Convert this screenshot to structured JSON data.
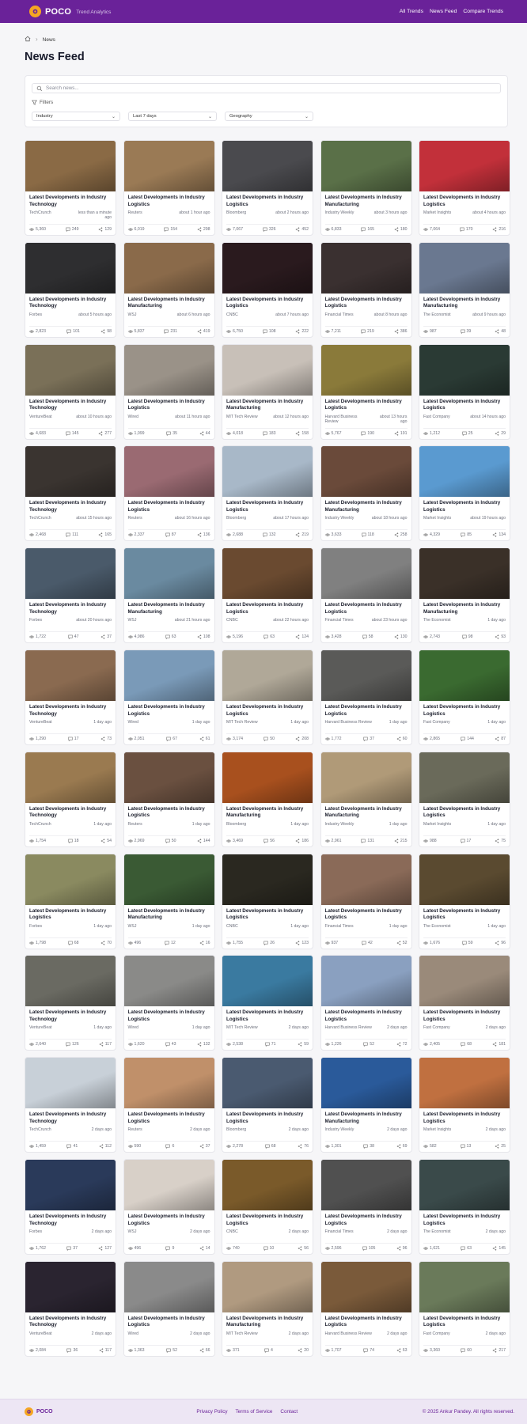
{
  "header": {
    "brand": "POCO",
    "tagline": "Trend Analytics",
    "nav": [
      "All Trends",
      "News Feed",
      "Compare Trends"
    ]
  },
  "breadcrumb": {
    "current": "News"
  },
  "page_title": "News Feed",
  "search": {
    "placeholder": "Search news..."
  },
  "filters": {
    "label": "Filters",
    "selects": [
      "Industry",
      "Last 7 days",
      "Geography"
    ]
  },
  "colors": {
    "brand": "#6a2299",
    "accent": "#f5a623"
  },
  "articles": [
    {
      "title": "Latest Developments in Industry Technology",
      "source": "TechCrunch",
      "time": "less than a minute ago",
      "views": "5,360",
      "comments": "249",
      "shares": "129",
      "img": "#8a6a45"
    },
    {
      "title": "Latest Developments in Industry Logistics",
      "source": "Reuters",
      "time": "about 1 hour ago",
      "views": "6,019",
      "comments": "154",
      "shares": "298",
      "img": "#9a7a55"
    },
    {
      "title": "Latest Developments in Industry Logistics",
      "source": "Bloomberg",
      "time": "about 2 hours ago",
      "views": "7,067",
      "comments": "326",
      "shares": "452",
      "img": "#4a4a4e"
    },
    {
      "title": "Latest Developments in Industry Manufacturing",
      "source": "Industry Weekly",
      "time": "about 3 hours ago",
      "views": "6,833",
      "comments": "165",
      "shares": "180",
      "img": "#5a7048"
    },
    {
      "title": "Latest Developments in Industry Logistics",
      "source": "Market Insights",
      "time": "about 4 hours ago",
      "views": "7,064",
      "comments": "170",
      "shares": "216",
      "img": "#c2303a"
    },
    {
      "title": "Latest Developments in Industry Technology",
      "source": "Forbes",
      "time": "about 5 hours ago",
      "views": "2,823",
      "comments": "101",
      "shares": "98",
      "img": "#2e2e30"
    },
    {
      "title": "Latest Developments in Industry Manufacturing",
      "source": "WSJ",
      "time": "about 6 hours ago",
      "views": "5,837",
      "comments": "231",
      "shares": "419",
      "img": "#8a6a4a"
    },
    {
      "title": "Latest Developments in Industry Logistics",
      "source": "CNBC",
      "time": "about 7 hours ago",
      "views": "6,750",
      "comments": "108",
      "shares": "222",
      "img": "#2a1a1e"
    },
    {
      "title": "Latest Developments in Industry Logistics",
      "source": "Financial Times",
      "time": "about 8 hours ago",
      "views": "7,211",
      "comments": "219",
      "shares": "386",
      "img": "#3a3030"
    },
    {
      "title": "Latest Developments in Industry Manufacturing",
      "source": "The Economist",
      "time": "about 9 hours ago",
      "views": "987",
      "comments": "39",
      "shares": "48",
      "img": "#6a7890"
    },
    {
      "title": "Latest Developments in Industry Technology",
      "source": "VentureBeat",
      "time": "about 10 hours ago",
      "views": "4,683",
      "comments": "145",
      "shares": "277",
      "img": "#7a7058"
    },
    {
      "title": "Latest Developments in Industry Logistics",
      "source": "Wired",
      "time": "about 11 hours ago",
      "views": "1,099",
      "comments": "35",
      "shares": "44",
      "img": "#9a9288"
    },
    {
      "title": "Latest Developments in Industry Manufacturing",
      "source": "MIT Tech Review",
      "time": "about 12 hours ago",
      "views": "4,018",
      "comments": "183",
      "shares": "158",
      "img": "#c8c0b8"
    },
    {
      "title": "Latest Developments in Industry Logistics",
      "source": "Harvard Business Review",
      "time": "about 13 hours ago",
      "views": "5,767",
      "comments": "190",
      "shares": "191",
      "img": "#8a7a3a"
    },
    {
      "title": "Latest Developments in Industry Logistics",
      "source": "Fast Company",
      "time": "about 14 hours ago",
      "views": "1,212",
      "comments": "25",
      "shares": "29",
      "img": "#2a3a34"
    },
    {
      "title": "Latest Developments in Industry Technology",
      "source": "TechCrunch",
      "time": "about 15 hours ago",
      "views": "2,468",
      "comments": "111",
      "shares": "165",
      "img": "#3a3430"
    },
    {
      "title": "Latest Developments in Industry Logistics",
      "source": "Reuters",
      "time": "about 16 hours ago",
      "views": "2,337",
      "comments": "87",
      "shares": "136",
      "img": "#9a6a72"
    },
    {
      "title": "Latest Developments in Industry Logistics",
      "source": "Bloomberg",
      "time": "about 17 hours ago",
      "views": "2,688",
      "comments": "132",
      "shares": "219",
      "img": "#a8b8c8"
    },
    {
      "title": "Latest Developments in Industry Manufacturing",
      "source": "Industry Weekly",
      "time": "about 18 hours ago",
      "views": "3,633",
      "comments": "118",
      "shares": "258",
      "img": "#6a4a3a"
    },
    {
      "title": "Latest Developments in Industry Logistics",
      "source": "Market Insights",
      "time": "about 19 hours ago",
      "views": "4,329",
      "comments": "85",
      "shares": "134",
      "img": "#5a9ad0"
    },
    {
      "title": "Latest Developments in Industry Technology",
      "source": "Forbes",
      "time": "about 20 hours ago",
      "views": "1,722",
      "comments": "47",
      "shares": "37",
      "img": "#4a5a6a"
    },
    {
      "title": "Latest Developments in Industry Manufacturing",
      "source": "WSJ",
      "time": "about 21 hours ago",
      "views": "4,986",
      "comments": "63",
      "shares": "108",
      "img": "#6a8aa0"
    },
    {
      "title": "Latest Developments in Industry Logistics",
      "source": "CNBC",
      "time": "about 22 hours ago",
      "views": "5,196",
      "comments": "63",
      "shares": "124",
      "img": "#6a4a30"
    },
    {
      "title": "Latest Developments in Industry Logistics",
      "source": "Financial Times",
      "time": "about 23 hours ago",
      "views": "3,428",
      "comments": "58",
      "shares": "130",
      "img": "#808080"
    },
    {
      "title": "Latest Developments in Industry Manufacturing",
      "source": "The Economist",
      "time": "1 day ago",
      "views": "2,743",
      "comments": "98",
      "shares": "93",
      "img": "#3a3028"
    },
    {
      "title": "Latest Developments in Industry Technology",
      "source": "VentureBeat",
      "time": "1 day ago",
      "views": "1,290",
      "comments": "17",
      "shares": "73",
      "img": "#8a6a50"
    },
    {
      "title": "Latest Developments in Industry Logistics",
      "source": "Wired",
      "time": "1 day ago",
      "views": "2,051",
      "comments": "67",
      "shares": "61",
      "img": "#7a9ab8"
    },
    {
      "title": "Latest Developments in Industry Logistics",
      "source": "MIT Tech Review",
      "time": "1 day ago",
      "views": "3,174",
      "comments": "50",
      "shares": "208",
      "img": "#b0a898"
    },
    {
      "title": "Latest Developments in Industry Logistics",
      "source": "Harvard Business Review",
      "time": "1 day ago",
      "views": "1,772",
      "comments": "37",
      "shares": "60",
      "img": "#5a5a58"
    },
    {
      "title": "Latest Developments in Industry Logistics",
      "source": "Fast Company",
      "time": "1 day ago",
      "views": "2,865",
      "comments": "144",
      "shares": "87",
      "img": "#3a6a30"
    },
    {
      "title": "Latest Developments in Industry Technology",
      "source": "TechCrunch",
      "time": "1 day ago",
      "views": "1,754",
      "comments": "18",
      "shares": "54",
      "img": "#9a7a50"
    },
    {
      "title": "Latest Developments in Industry Logistics",
      "source": "Reuters",
      "time": "1 day ago",
      "views": "2,969",
      "comments": "50",
      "shares": "144",
      "img": "#6a5040"
    },
    {
      "title": "Latest Developments in Industry Manufacturing",
      "source": "Bloomberg",
      "time": "1 day ago",
      "views": "3,469",
      "comments": "56",
      "shares": "186",
      "img": "#a8501e"
    },
    {
      "title": "Latest Developments in Industry Manufacturing",
      "source": "Industry Weekly",
      "time": "1 day ago",
      "views": "2,961",
      "comments": "131",
      "shares": "215",
      "img": "#b09a78"
    },
    {
      "title": "Latest Developments in Industry Logistics",
      "source": "Market Insights",
      "time": "1 day ago",
      "views": "988",
      "comments": "17",
      "shares": "75",
      "img": "#6a6a5a"
    },
    {
      "title": "Latest Developments in Industry Logistics",
      "source": "Forbes",
      "time": "1 day ago",
      "views": "1,798",
      "comments": "68",
      "shares": "70",
      "img": "#8a8a60"
    },
    {
      "title": "Latest Developments in Industry Manufacturing",
      "source": "WSJ",
      "time": "1 day ago",
      "views": "496",
      "comments": "12",
      "shares": "16",
      "img": "#3a5a34"
    },
    {
      "title": "Latest Developments in Industry Logistics",
      "source": "CNBC",
      "time": "1 day ago",
      "views": "1,755",
      "comments": "26",
      "shares": "123",
      "img": "#2a2820"
    },
    {
      "title": "Latest Developments in Industry Logistics",
      "source": "Financial Times",
      "time": "1 day ago",
      "views": "937",
      "comments": "42",
      "shares": "52",
      "img": "#8a6a58"
    },
    {
      "title": "Latest Developments in Industry Logistics",
      "source": "The Economist",
      "time": "1 day ago",
      "views": "1,676",
      "comments": "59",
      "shares": "96",
      "img": "#5a4a30"
    },
    {
      "title": "Latest Developments in Industry Technology",
      "source": "VentureBeat",
      "time": "1 day ago",
      "views": "2,640",
      "comments": "126",
      "shares": "117",
      "img": "#6a6a62"
    },
    {
      "title": "Latest Developments in Industry Logistics",
      "source": "Wired",
      "time": "1 day ago",
      "views": "1,620",
      "comments": "43",
      "shares": "132",
      "img": "#8a8a88"
    },
    {
      "title": "Latest Developments in Industry Logistics",
      "source": "MIT Tech Review",
      "time": "2 days ago",
      "views": "2,538",
      "comments": "71",
      "shares": "59",
      "img": "#3a7aa0"
    },
    {
      "title": "Latest Developments in Industry Logistics",
      "source": "Harvard Business Review",
      "time": "2 days ago",
      "views": "1,226",
      "comments": "52",
      "shares": "72",
      "img": "#8aa0c0"
    },
    {
      "title": "Latest Developments in Industry Logistics",
      "source": "Fast Company",
      "time": "2 days ago",
      "views": "2,405",
      "comments": "68",
      "shares": "181",
      "img": "#9a8a7a"
    },
    {
      "title": "Latest Developments in Industry Technology",
      "source": "TechCrunch",
      "time": "2 days ago",
      "views": "1,459",
      "comments": "41",
      "shares": "112",
      "img": "#c8d0d8"
    },
    {
      "title": "Latest Developments in Industry Logistics",
      "source": "Reuters",
      "time": "2 days ago",
      "views": "590",
      "comments": "6",
      "shares": "37",
      "img": "#c0906a"
    },
    {
      "title": "Latest Developments in Industry Logistics",
      "source": "Bloomberg",
      "time": "2 days ago",
      "views": "2,278",
      "comments": "68",
      "shares": "76",
      "img": "#4a5a70"
    },
    {
      "title": "Latest Developments in Industry Manufacturing",
      "source": "Industry Weekly",
      "time": "2 days ago",
      "views": "1,301",
      "comments": "38",
      "shares": "69",
      "img": "#2a5a9a"
    },
    {
      "title": "Latest Developments in Industry Logistics",
      "source": "Market Insights",
      "time": "2 days ago",
      "views": "582",
      "comments": "13",
      "shares": "25",
      "img": "#c07040"
    },
    {
      "title": "Latest Developments in Industry Technology",
      "source": "Forbes",
      "time": "2 days ago",
      "views": "1,762",
      "comments": "37",
      "shares": "127",
      "img": "#2a3a5a"
    },
    {
      "title": "Latest Developments in Industry Logistics",
      "source": "WSJ",
      "time": "2 days ago",
      "views": "496",
      "comments": "9",
      "shares": "14",
      "img": "#d8d0c8"
    },
    {
      "title": "Latest Developments in Industry Logistics",
      "source": "CNBC",
      "time": "2 days ago",
      "views": "740",
      "comments": "10",
      "shares": "56",
      "img": "#7a5a2a"
    },
    {
      "title": "Latest Developments in Industry Logistics",
      "source": "Financial Times",
      "time": "2 days ago",
      "views": "2,596",
      "comments": "105",
      "shares": "96",
      "img": "#505050"
    },
    {
      "title": "Latest Developments in Industry Logistics",
      "source": "The Economist",
      "time": "2 days ago",
      "views": "1,621",
      "comments": "63",
      "shares": "145",
      "img": "#3a4a4a"
    },
    {
      "title": "Latest Developments in Industry Technology",
      "source": "VentureBeat",
      "time": "2 days ago",
      "views": "2,084",
      "comments": "36",
      "shares": "117",
      "img": "#2a2430"
    },
    {
      "title": "Latest Developments in Industry Logistics",
      "source": "Wired",
      "time": "2 days ago",
      "views": "1,363",
      "comments": "52",
      "shares": "66",
      "img": "#8a8a8a"
    },
    {
      "title": "Latest Developments in Industry Manufacturing",
      "source": "MIT Tech Review",
      "time": "2 days ago",
      "views": "371",
      "comments": "4",
      "shares": "20",
      "img": "#b09a80"
    },
    {
      "title": "Latest Developments in Industry Logistics",
      "source": "Harvard Business Review",
      "time": "2 days ago",
      "views": "1,707",
      "comments": "74",
      "shares": "63",
      "img": "#7a5a3a"
    },
    {
      "title": "Latest Developments in Industry Logistics",
      "source": "Fast Company",
      "time": "2 days ago",
      "views": "3,360",
      "comments": "60",
      "shares": "217",
      "img": "#6a7a5a"
    }
  ],
  "footer": {
    "brand": "POCO",
    "links": [
      "Privacy Policy",
      "Terms of Service",
      "Contact"
    ],
    "copyright": "© 2025 Ankur Pandey. All rights reserved."
  }
}
